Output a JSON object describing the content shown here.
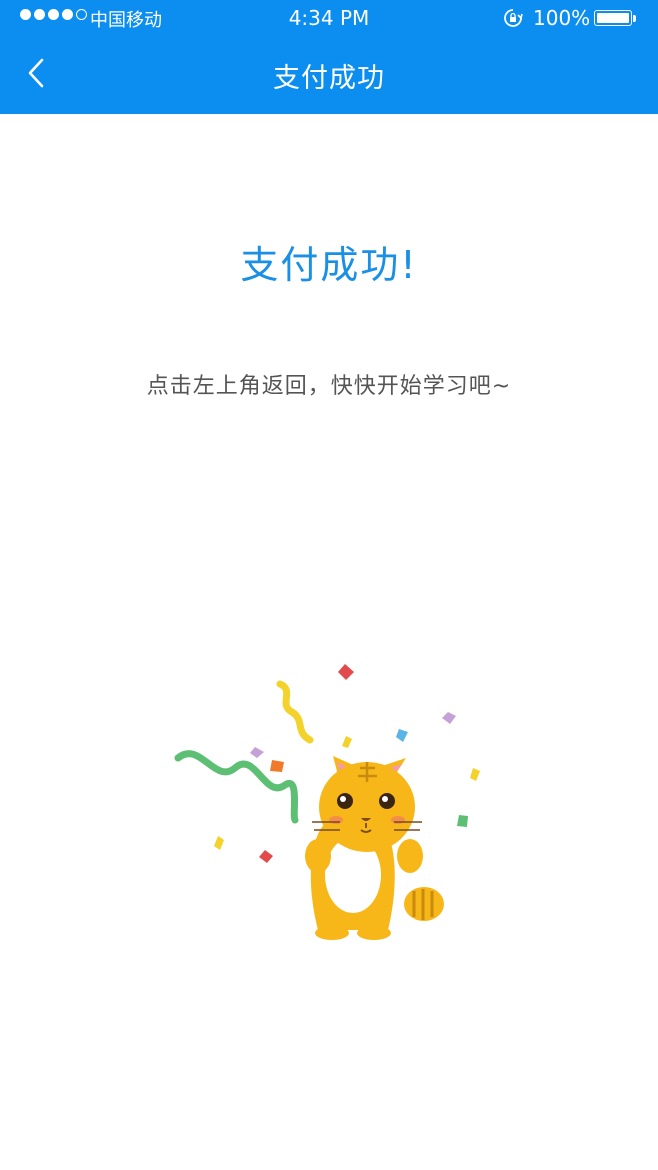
{
  "status_bar": {
    "carrier": "中国移动",
    "time": "4:34 PM",
    "battery": "100%",
    "signal_bars_filled": 4,
    "signal_bars_total": 5
  },
  "nav": {
    "title": "支付成功",
    "back_icon": "chevron-left-icon"
  },
  "main": {
    "title": "支付成功!",
    "subtitle": "点击左上角返回，快快开始学习吧~"
  },
  "colors": {
    "header_bg": "#0c8ef0",
    "title_blue": "#1a8fe6",
    "subtitle_gray": "#555555",
    "mascot_yellow": "#f7b719"
  }
}
